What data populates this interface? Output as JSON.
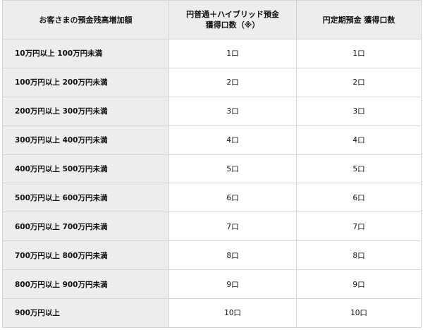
{
  "table": {
    "headers": {
      "col1": "お客さまの預金残高増加額",
      "col2_line1": "円普通＋ハイブリッド預金",
      "col2_line2": "獲得口数（※）",
      "col3": "円定期預金 獲得口数"
    },
    "rows": [
      {
        "label": "10万円以上 100万円未満",
        "a": "1口",
        "b": "1口"
      },
      {
        "label": "100万円以上 200万円未満",
        "a": "2口",
        "b": "2口"
      },
      {
        "label": "200万円以上 300万円未満",
        "a": "3口",
        "b": "3口"
      },
      {
        "label": "300万円以上 400万円未満",
        "a": "4口",
        "b": "4口"
      },
      {
        "label": "400万円以上 500万円未満",
        "a": "5口",
        "b": "5口"
      },
      {
        "label": "500万円以上 600万円未満",
        "a": "6口",
        "b": "6口"
      },
      {
        "label": "600万円以上 700万円未満",
        "a": "7口",
        "b": "7口"
      },
      {
        "label": "700万円以上 800万円未満",
        "a": "8口",
        "b": "8口"
      },
      {
        "label": "800万円以上 900万円未満",
        "a": "9口",
        "b": "9口"
      },
      {
        "label": "900万円以上",
        "a": "10口",
        "b": "10口"
      }
    ]
  }
}
